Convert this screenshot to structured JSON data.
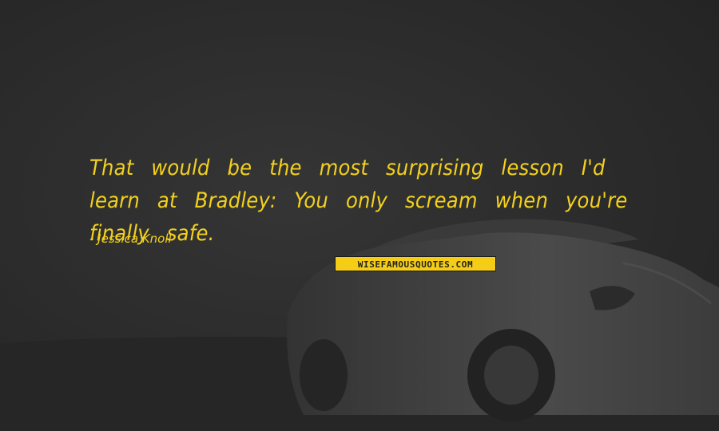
{
  "quote": {
    "text": "That would be the most surprising lesson I'd learn at Bradley: You only scream when you're finally safe.",
    "author": "- Jessica Knoll",
    "text_color": "#f3d11d"
  },
  "badge": {
    "text": "WISEFAMOUSQUOTES.COM",
    "background": "#f5cd16"
  },
  "background": {
    "color": "#2a2a2a",
    "subject": "car-photo"
  }
}
